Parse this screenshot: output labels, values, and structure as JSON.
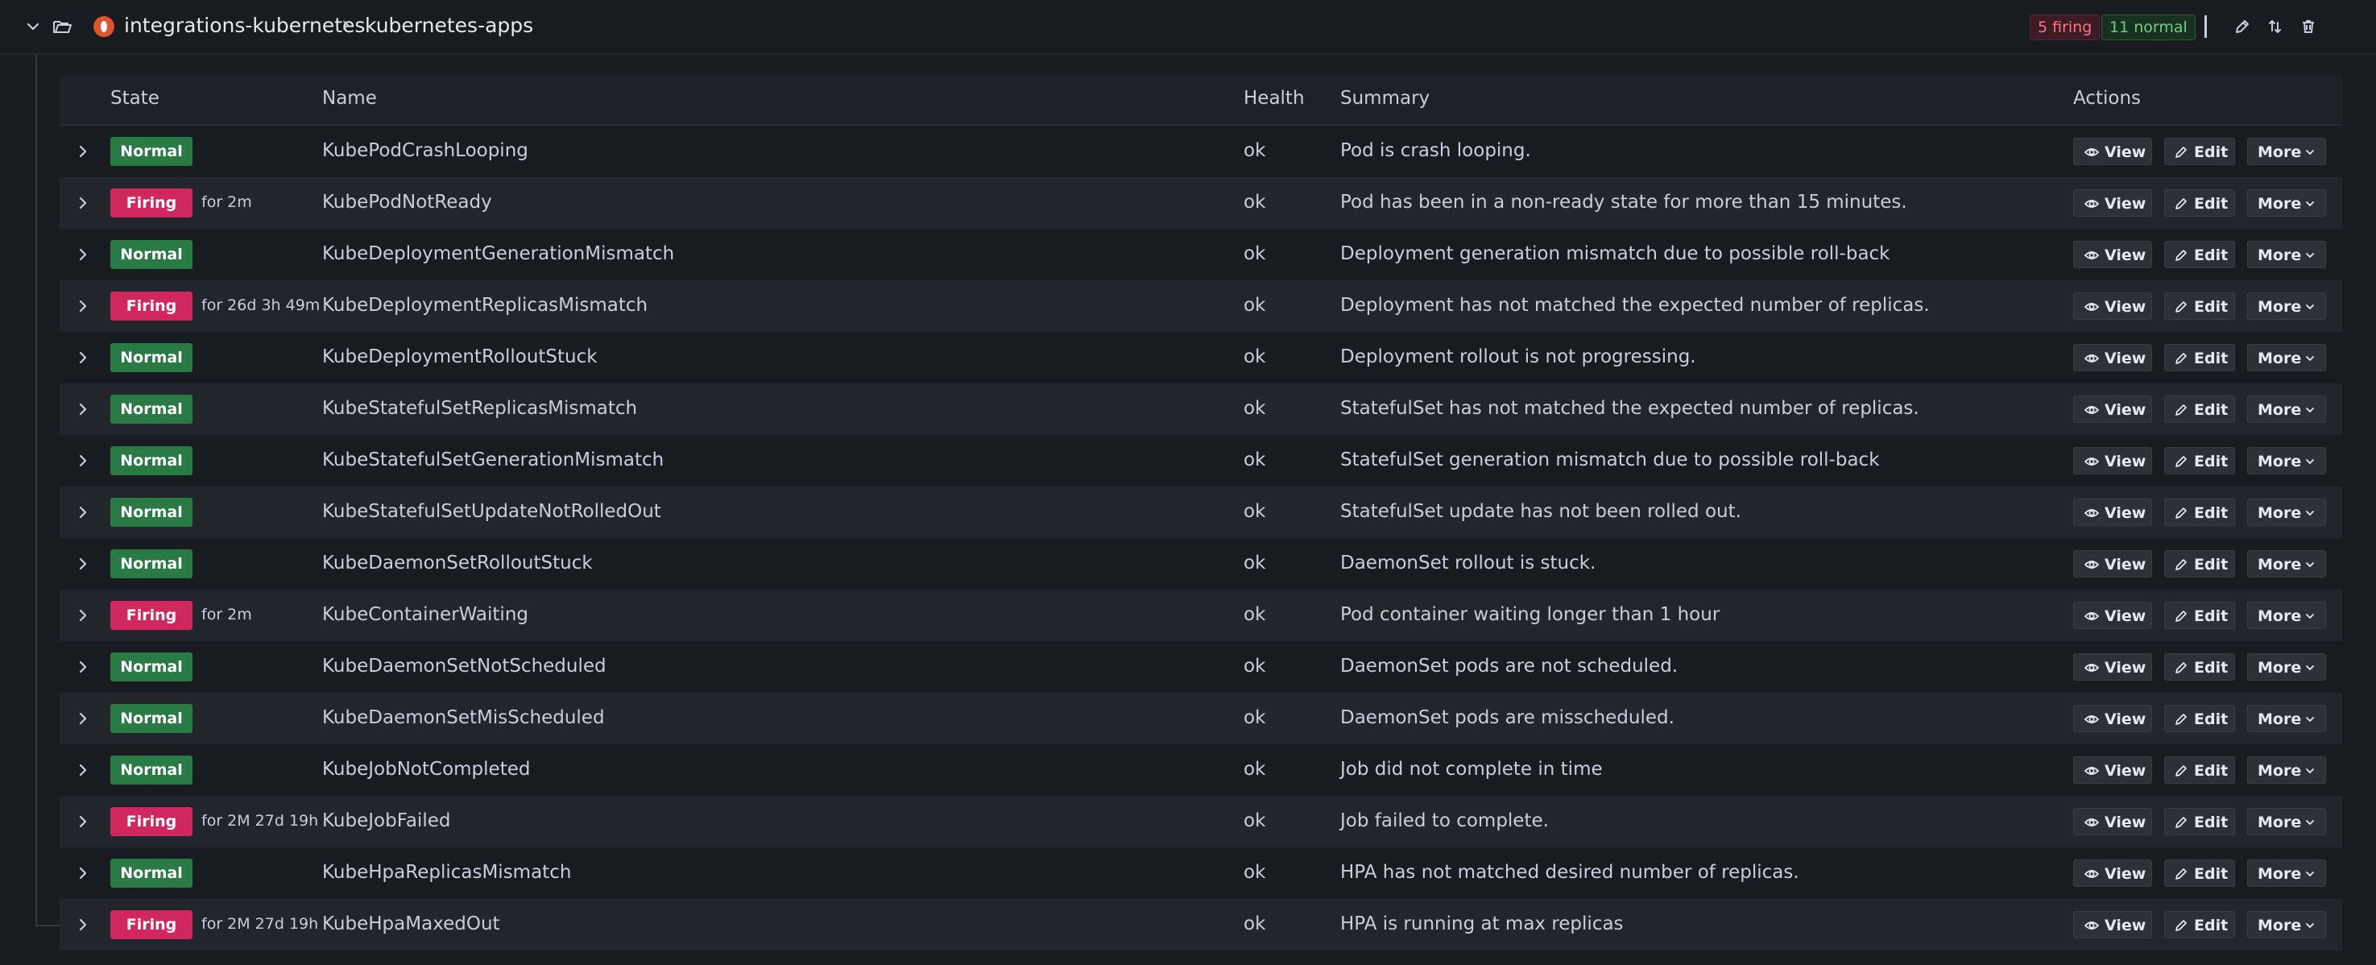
{
  "header": {
    "namespace": "integrations-kubernetes",
    "separator": "›",
    "group": "kubernetes-apps",
    "firing_badge": "5 firing",
    "normal_badge": "11 normal"
  },
  "table": {
    "columns": {
      "state": "State",
      "name": "Name",
      "health": "Health",
      "summary": "Summary",
      "actions": "Actions"
    },
    "actions": {
      "view": "View",
      "edit": "Edit",
      "more": "More"
    },
    "rows": [
      {
        "state": "Normal",
        "for": "",
        "name": "KubePodCrashLooping",
        "health": "ok",
        "summary": "Pod is crash looping."
      },
      {
        "state": "Firing",
        "for": "for 2m",
        "name": "KubePodNotReady",
        "health": "ok",
        "summary": "Pod has been in a non-ready state for more than 15 minutes."
      },
      {
        "state": "Normal",
        "for": "",
        "name": "KubeDeploymentGenerationMismatch",
        "health": "ok",
        "summary": "Deployment generation mismatch due to possible roll-back"
      },
      {
        "state": "Firing",
        "for": "for 26d 3h 49m",
        "name": "KubeDeploymentReplicasMismatch",
        "health": "ok",
        "summary": "Deployment has not matched the expected number of replicas."
      },
      {
        "state": "Normal",
        "for": "",
        "name": "KubeDeploymentRolloutStuck",
        "health": "ok",
        "summary": "Deployment rollout is not progressing."
      },
      {
        "state": "Normal",
        "for": "",
        "name": "KubeStatefulSetReplicasMismatch",
        "health": "ok",
        "summary": "StatefulSet has not matched the expected number of replicas."
      },
      {
        "state": "Normal",
        "for": "",
        "name": "KubeStatefulSetGenerationMismatch",
        "health": "ok",
        "summary": "StatefulSet generation mismatch due to possible roll-back"
      },
      {
        "state": "Normal",
        "for": "",
        "name": "KubeStatefulSetUpdateNotRolledOut",
        "health": "ok",
        "summary": "StatefulSet update has not been rolled out."
      },
      {
        "state": "Normal",
        "for": "",
        "name": "KubeDaemonSetRolloutStuck",
        "health": "ok",
        "summary": "DaemonSet rollout is stuck."
      },
      {
        "state": "Firing",
        "for": "for 2m",
        "name": "KubeContainerWaiting",
        "health": "ok",
        "summary": "Pod container waiting longer than 1 hour"
      },
      {
        "state": "Normal",
        "for": "",
        "name": "KubeDaemonSetNotScheduled",
        "health": "ok",
        "summary": "DaemonSet pods are not scheduled."
      },
      {
        "state": "Normal",
        "for": "",
        "name": "KubeDaemonSetMisScheduled",
        "health": "ok",
        "summary": "DaemonSet pods are misscheduled."
      },
      {
        "state": "Normal",
        "for": "",
        "name": "KubeJobNotCompleted",
        "health": "ok",
        "summary": "Job did not complete in time"
      },
      {
        "state": "Firing",
        "for": "for 2M 27d 19h",
        "name": "KubeJobFailed",
        "health": "ok",
        "summary": "Job failed to complete."
      },
      {
        "state": "Normal",
        "for": "",
        "name": "KubeHpaReplicasMismatch",
        "health": "ok",
        "summary": "HPA has not matched desired number of replicas."
      },
      {
        "state": "Firing",
        "for": "for 2M 27d 19h",
        "name": "KubeHpaMaxedOut",
        "health": "ok",
        "summary": "HPA is running at max replicas"
      }
    ]
  },
  "colors": {
    "normal": "#2a7a45",
    "firing": "#d0275f",
    "background": "#181b1f"
  },
  "icons": {
    "collapse": "chevron-down-icon",
    "folder": "folder-open-icon",
    "datasource": "prometheus-logo",
    "edit": "pencil-icon",
    "export": "export-icon",
    "delete": "trash-icon",
    "expand_row": "chevron-right-icon",
    "view": "eye-icon",
    "more": "chevron-down-icon"
  }
}
